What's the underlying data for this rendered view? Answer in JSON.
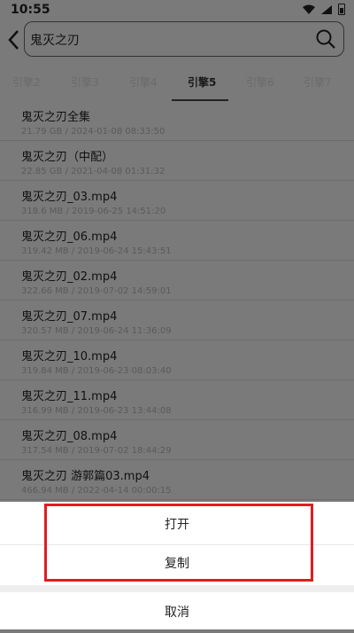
{
  "status_bar": {
    "time": "10:55"
  },
  "search": {
    "query": "鬼灭之刃"
  },
  "tabs": [
    {
      "label": "引擎2",
      "active": false
    },
    {
      "label": "引擎3",
      "active": false
    },
    {
      "label": "引擎4",
      "active": false
    },
    {
      "label": "引擎5",
      "active": true
    },
    {
      "label": "引擎6",
      "active": false
    },
    {
      "label": "引擎7",
      "active": false
    }
  ],
  "files": [
    {
      "name": "鬼灭之刃全集",
      "meta": "21.79 GB / 2024-01-08 08:33:50"
    },
    {
      "name": "鬼灭之刃（中配）",
      "meta": "22.85 GB / 2021-04-08 01:31:32"
    },
    {
      "name": "鬼灭之刃_03.mp4",
      "meta": "318.6 MB / 2019-06-25 14:51:20"
    },
    {
      "name": "鬼灭之刃_06.mp4",
      "meta": "319.42 MB / 2019-06-24 15:43:51"
    },
    {
      "name": "鬼灭之刃_02.mp4",
      "meta": "322.66 MB / 2019-07-02 14:59:01"
    },
    {
      "name": "鬼灭之刃_07.mp4",
      "meta": "320.57 MB / 2019-06-24 11:36:09"
    },
    {
      "name": "鬼灭之刃_10.mp4",
      "meta": "319.84 MB / 2019-06-23 08:03:40"
    },
    {
      "name": "鬼灭之刃_11.mp4",
      "meta": "316.99 MB / 2019-06-23 13:44:08"
    },
    {
      "name": "鬼灭之刃_08.mp4",
      "meta": "317.54 MB / 2019-07-02 18:44:29"
    },
    {
      "name": "鬼灭之刃 游郭篇03.mp4",
      "meta": "466.94 MB / 2022-04-14 00:00:15"
    }
  ],
  "action_sheet": {
    "open_label": "打开",
    "copy_label": "复制",
    "cancel_label": "取消"
  },
  "colors": {
    "highlight": "#e21b23",
    "overlay": "#7a7a7a"
  }
}
